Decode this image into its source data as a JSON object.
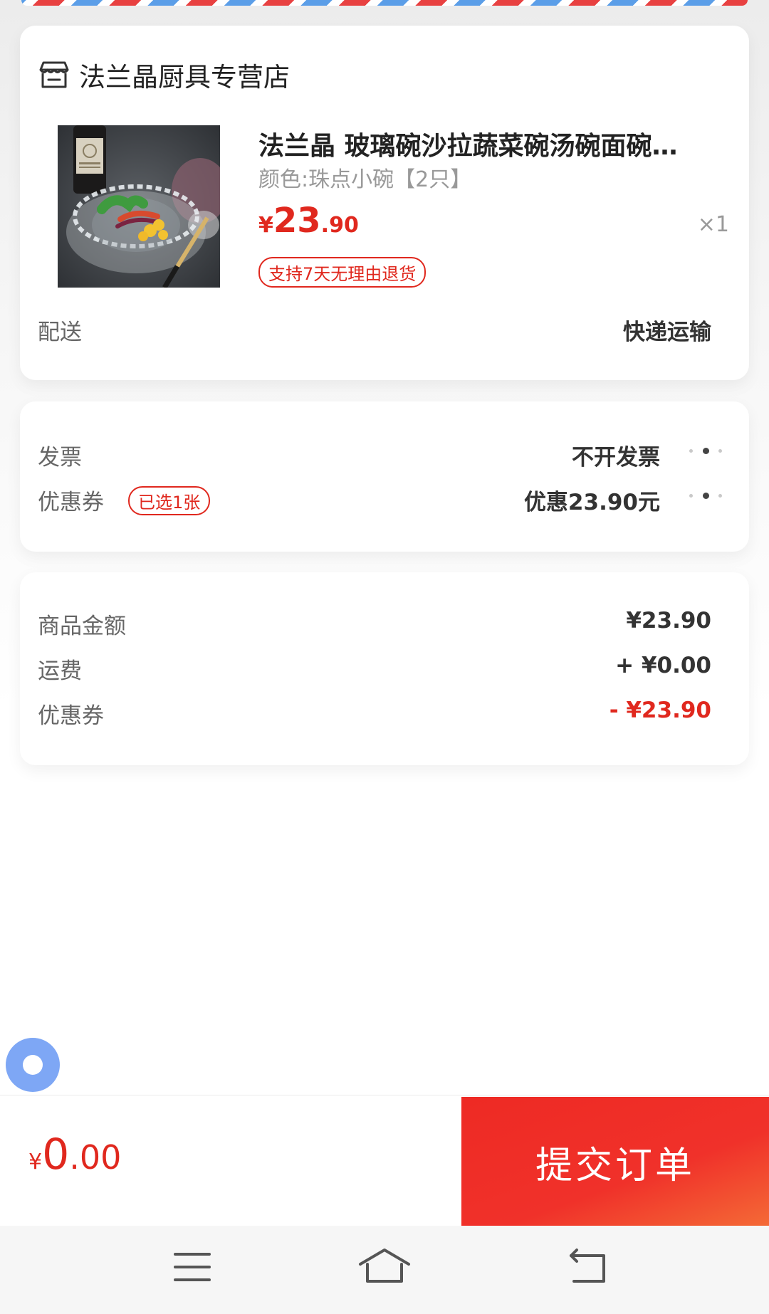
{
  "store": {
    "name": "法兰晶厨具专营店",
    "icon": "store-icon"
  },
  "product": {
    "title": "法兰晶 玻璃碗沙拉蔬菜碗汤碗面碗…",
    "variant": "颜色:珠点小碗【2只】",
    "price_currency": "¥",
    "price_integer": "23",
    "price_decimal": ".90",
    "quantity": "×1",
    "return_badge": "支持7天无理由退货",
    "image": "glass-salad-bowl-photo"
  },
  "delivery": {
    "label": "配送",
    "value": "快递运输"
  },
  "invoice": {
    "label": "发票",
    "value": "不开发票",
    "icon": "more-dots-icon"
  },
  "coupon": {
    "label": "优惠券",
    "badge": "已选1张",
    "value": "优惠23.90元",
    "icon": "more-dots-icon"
  },
  "summary": {
    "rows": [
      {
        "label": "商品金额",
        "value": "¥23.90"
      },
      {
        "label": "运费",
        "value": "+ ¥0.00"
      },
      {
        "label": "优惠券",
        "value": "- ¥23.90"
      }
    ]
  },
  "footer": {
    "total_currency": "¥",
    "total_integer": "0",
    "total_decimal": ".00",
    "submit_label": "提交订单"
  },
  "nav": {
    "menu_icon": "menu-icon",
    "home_icon": "home-icon",
    "back_icon": "back-icon"
  },
  "colors": {
    "accent_red": "#e0281e",
    "airmail_red": "#e84141",
    "airmail_blue": "#5b9ee8",
    "float_button_blue": "#7ea7f5"
  }
}
